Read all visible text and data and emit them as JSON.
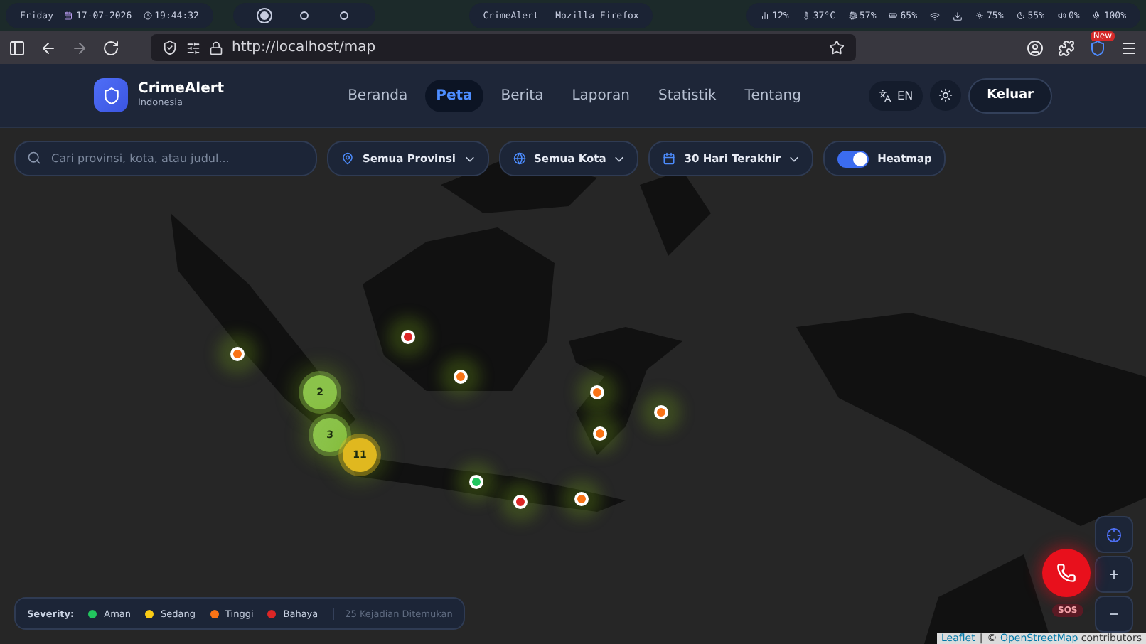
{
  "os_bar": {
    "day": "Friday",
    "date": "17-07-2026",
    "time": "19:44:32",
    "workspaces": [
      {
        "selected": true
      },
      {
        "selected": false
      },
      {
        "selected": false
      }
    ],
    "window_title": "CrimeAlert — Mozilla Firefox",
    "status": [
      "12%",
      "37°C",
      "57%",
      "65%",
      "75%",
      "55%",
      "0%",
      "100%"
    ]
  },
  "browser": {
    "url": "http://localhost/map",
    "extension_badge": "New"
  },
  "nav": {
    "brand": "CrimeAlert",
    "brand_sub": "Indonesia",
    "links": [
      {
        "label": "Beranda",
        "selected": false
      },
      {
        "label": "Peta",
        "selected": true
      },
      {
        "label": "Berita",
        "selected": false
      },
      {
        "label": "Laporan",
        "selected": false
      },
      {
        "label": "Statistik",
        "selected": false
      },
      {
        "label": "Tentang",
        "selected": false
      }
    ],
    "language": "EN",
    "logout": "Keluar"
  },
  "filters": {
    "search": {
      "placeholder": "Cari provinsi, kota, atau judul..."
    },
    "dropdowns": [
      {
        "kind": "province",
        "label": "Semua Provinsi"
      },
      {
        "kind": "city",
        "label": "Semua Kota"
      },
      {
        "kind": "date",
        "label": "30 Hari Terakhir"
      }
    ],
    "heatmap": {
      "label": "Heatmap",
      "on": true
    }
  },
  "markers": [
    {
      "color": "#f97316"
    },
    {
      "color": "#dc2626"
    },
    {
      "color": "#f97316"
    },
    {
      "color": "#f97316"
    },
    {
      "color": "#f97316"
    },
    {
      "color": "#f97316"
    },
    {
      "color": "#22c55e"
    },
    {
      "color": "#dc2626"
    },
    {
      "color": "#f97316"
    }
  ],
  "clusters": [
    {
      "count": "2",
      "color": "#8bc34a"
    },
    {
      "count": "3",
      "color": "#8bc34a"
    },
    {
      "count": "11",
      "color": "#e0b81f"
    }
  ],
  "legend": {
    "title": "Severity:",
    "items": [
      {
        "label": "Aman",
        "color": "#22c55e"
      },
      {
        "label": "Sedang",
        "color": "#facc15"
      },
      {
        "label": "Tinggi",
        "color": "#f97316"
      },
      {
        "label": "Bahaya",
        "color": "#dc2626"
      }
    ],
    "count": "25 Kejadian Ditemukan"
  },
  "sos": {
    "label": "SOS"
  },
  "zoom": {
    "in": "+",
    "out": "−"
  },
  "attribution": {
    "leaflet": "Leaflet",
    "separator": "|",
    "prefix": "©",
    "osm": "OpenStreetMap",
    "suffix": "contributors"
  }
}
